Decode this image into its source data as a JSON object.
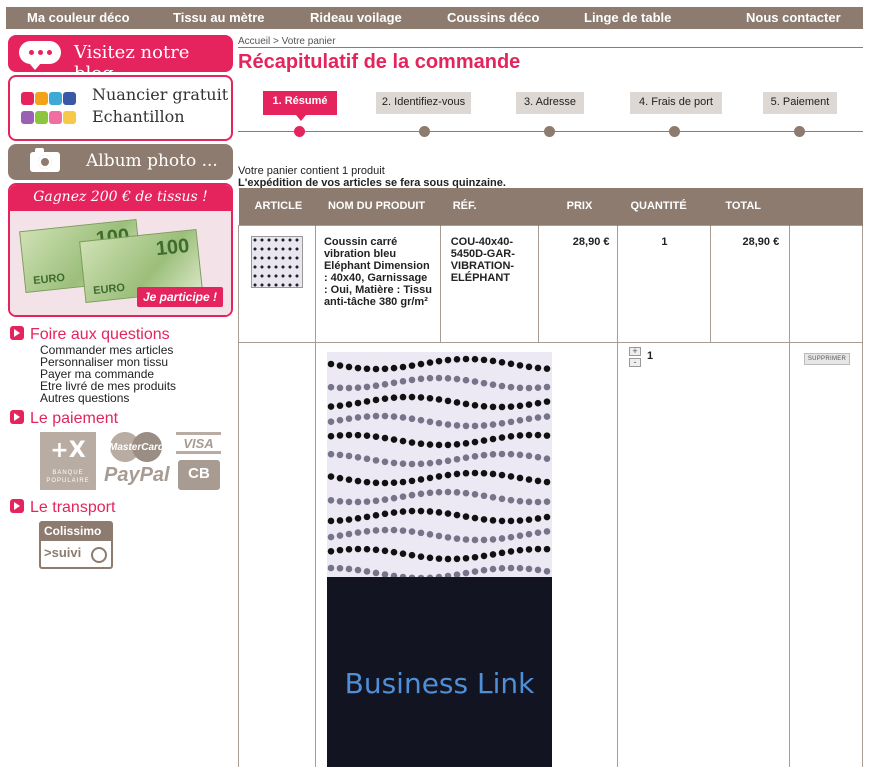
{
  "nav": {
    "items": [
      "Ma couleur déco",
      "Tissu au mètre",
      "Rideau voilage",
      "Coussins déco",
      "Linge de table",
      "Nous contacter"
    ]
  },
  "sidebar": {
    "blog": "Visitez notre blog",
    "nuancier_line1": "Nuancier gratuit",
    "nuancier_line2": "Echantillon",
    "album": "Album photo ...",
    "promo_title": "Gagnez 200 € de tissus !",
    "promo_button": "Je participe !",
    "banknote_value": "100",
    "banknote_currency": "EURO",
    "faq_title": "Foire aux questions",
    "faq_links": [
      "Commander mes articles",
      "Personnaliser mon tissu",
      "Payer ma commande",
      "Etre livré de mes produits",
      "Autres questions"
    ],
    "payment_title": "Le paiement",
    "payment_bp_mark": "+X",
    "payment_bp_text": "BANQUE POPULAIRE",
    "payment_mastercard": "MasterCard",
    "payment_paypal": "PayPal",
    "payment_visa": "VISA",
    "payment_cb": "CB",
    "transport_title": "Le transport",
    "colissimo_top": "Colissimo",
    "colissimo_bottom": ">suivi"
  },
  "breadcrumb": "Accueil  >  Votre panier",
  "page_title": "Récapitulatif de la commande",
  "steps": [
    {
      "label": "1. Résumé",
      "active": true
    },
    {
      "label": "2. Identifiez-vous",
      "active": false
    },
    {
      "label": "3. Adresse",
      "active": false
    },
    {
      "label": "4. Frais de port",
      "active": false
    },
    {
      "label": "5. Paiement",
      "active": false
    }
  ],
  "cart_info": "Votre panier contient 1 produit",
  "shipping_info": "L'expédition de vos articles se fera sous quinzaine.",
  "table": {
    "headers": [
      "ARTICLE",
      "NOM DU PRODUIT",
      "RÉF.",
      "PRIX",
      "QUANTITÉ",
      "TOTAL"
    ],
    "row": {
      "name": "Coussin carré vibration bleu Eléphant Dimension : 40x40, Garnissage : Oui, Matière : Tissu anti-tâche 380 gr/m²",
      "ref": "COU-40x40-5450D-GAR-VIBRATION-ELÉPHANT",
      "price": "28,90 €",
      "quantity": "1",
      "total": "28,90 €"
    },
    "qty_plus": "+",
    "qty_minus": "-",
    "qty_value": "1",
    "delete_label": "SUPPRIMER",
    "ad_text": "Business Link"
  },
  "colors": {
    "accent": "#e5245e",
    "taupe": "#8c7b6e"
  }
}
